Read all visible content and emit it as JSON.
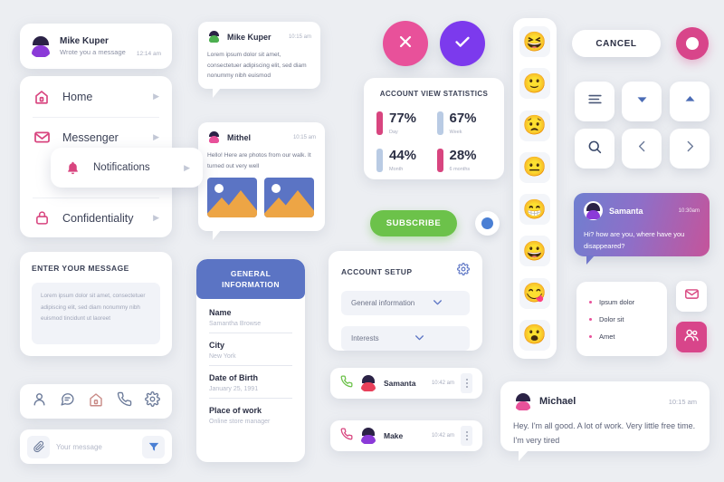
{
  "notification": {
    "name": "Mike Kuper",
    "subtitle": "Wrote you a message",
    "time": "12:14 am"
  },
  "nav": {
    "items": [
      {
        "label": "Home",
        "icon": "home-icon"
      },
      {
        "label": "Messenger",
        "icon": "envelope-icon"
      },
      {
        "label": "Confidentiality",
        "icon": "lock-icon"
      }
    ],
    "floating": {
      "label": "Notifications",
      "icon": "bell-icon"
    }
  },
  "message_one": {
    "name": "Mike Kuper",
    "time": "10:15 am",
    "body": "Lorem ipsum dolor sit amet, consectetuer adipiscing elit, sed diam nonummy nibh euismod"
  },
  "message_two": {
    "name": "Mithel",
    "time": "10:15 am",
    "body": "Hello! Here are photos from our walk. It turned out very well"
  },
  "statistics": {
    "title": "ACCOUNT VIEW STATISTICS",
    "items": [
      {
        "value": "77%",
        "label": "Day",
        "color": "#d8457f"
      },
      {
        "value": "67%",
        "label": "Week",
        "color": "#b9cbe4"
      },
      {
        "value": "44%",
        "label": "Month",
        "color": "#b9cbe4"
      },
      {
        "value": "28%",
        "label": "6 months",
        "color": "#d8457f"
      }
    ]
  },
  "subscribe": {
    "label": "SUBSCRIBE",
    "color": "#6cc24a"
  },
  "account_setup": {
    "title": "ACCOUNT SETUP",
    "rows": [
      {
        "label": "General information"
      },
      {
        "label": "Interests"
      }
    ]
  },
  "contacts": [
    {
      "name": "Samanta",
      "time": "10:42 am",
      "call": "answer"
    },
    {
      "name": "Make",
      "time": "10:42 am",
      "call": "decline"
    }
  ],
  "enter_message": {
    "title": "ENTER YOUR MESSAGE",
    "placeholder": "Lorem ipsum dolor sit amet, consectetuer adipiscing elit, sed diam nonummy nibh euismod tincidunt ut laoreet"
  },
  "icon_bar": [
    "user-icon",
    "chat-icon",
    "home-icon",
    "phone-icon",
    "gear-icon"
  ],
  "message_input": {
    "placeholder": "Your message",
    "attach_icon": "paperclip-icon",
    "send_icon": "send-icon"
  },
  "general_information": {
    "header_line1": "GENERAL",
    "header_line2": "INFORMATION",
    "fields": [
      {
        "label": "Name",
        "value": "Samantha Browse"
      },
      {
        "label": "City",
        "value": "New York"
      },
      {
        "label": "Date of Birth",
        "value": "January 25, 1991"
      },
      {
        "label": "Place of work",
        "value": "Online store manager"
      }
    ]
  },
  "emojis": [
    "😆",
    "🙂",
    "😟",
    "😐",
    "😁",
    "😀",
    "😋",
    "😮"
  ],
  "buttons": {
    "cancel": "CANCEL",
    "record_icon": "record-icon",
    "close_icon": "close-icon",
    "check_icon": "check-icon",
    "squares": [
      {
        "icon": "menu-icon"
      },
      {
        "icon": "caret-down-icon"
      },
      {
        "icon": "caret-up-icon"
      },
      {
        "icon": "search-icon"
      },
      {
        "icon": "chevron-left-icon"
      },
      {
        "icon": "chevron-right-icon"
      }
    ]
  },
  "samanta_chat": {
    "name": "Samanta",
    "time": "10:30am",
    "body": "Hi? how are you, where have you disappeared?"
  },
  "bullets": [
    "Ipsum dolor",
    "Dolor sit",
    "Amet"
  ],
  "side_squares": [
    {
      "icon": "mail-icon"
    },
    {
      "icon": "users-icon"
    }
  ],
  "michael": {
    "name": "Michael",
    "time": "10:15 am",
    "body": "Hey. I'm all good. A lot of work. Very little free time. I'm very tired"
  },
  "colors": {
    "pink": "#d8457f",
    "purple": "#7c3aed",
    "blue": "#5b74c4",
    "green": "#6cc24a",
    "background": "#eceef2"
  }
}
